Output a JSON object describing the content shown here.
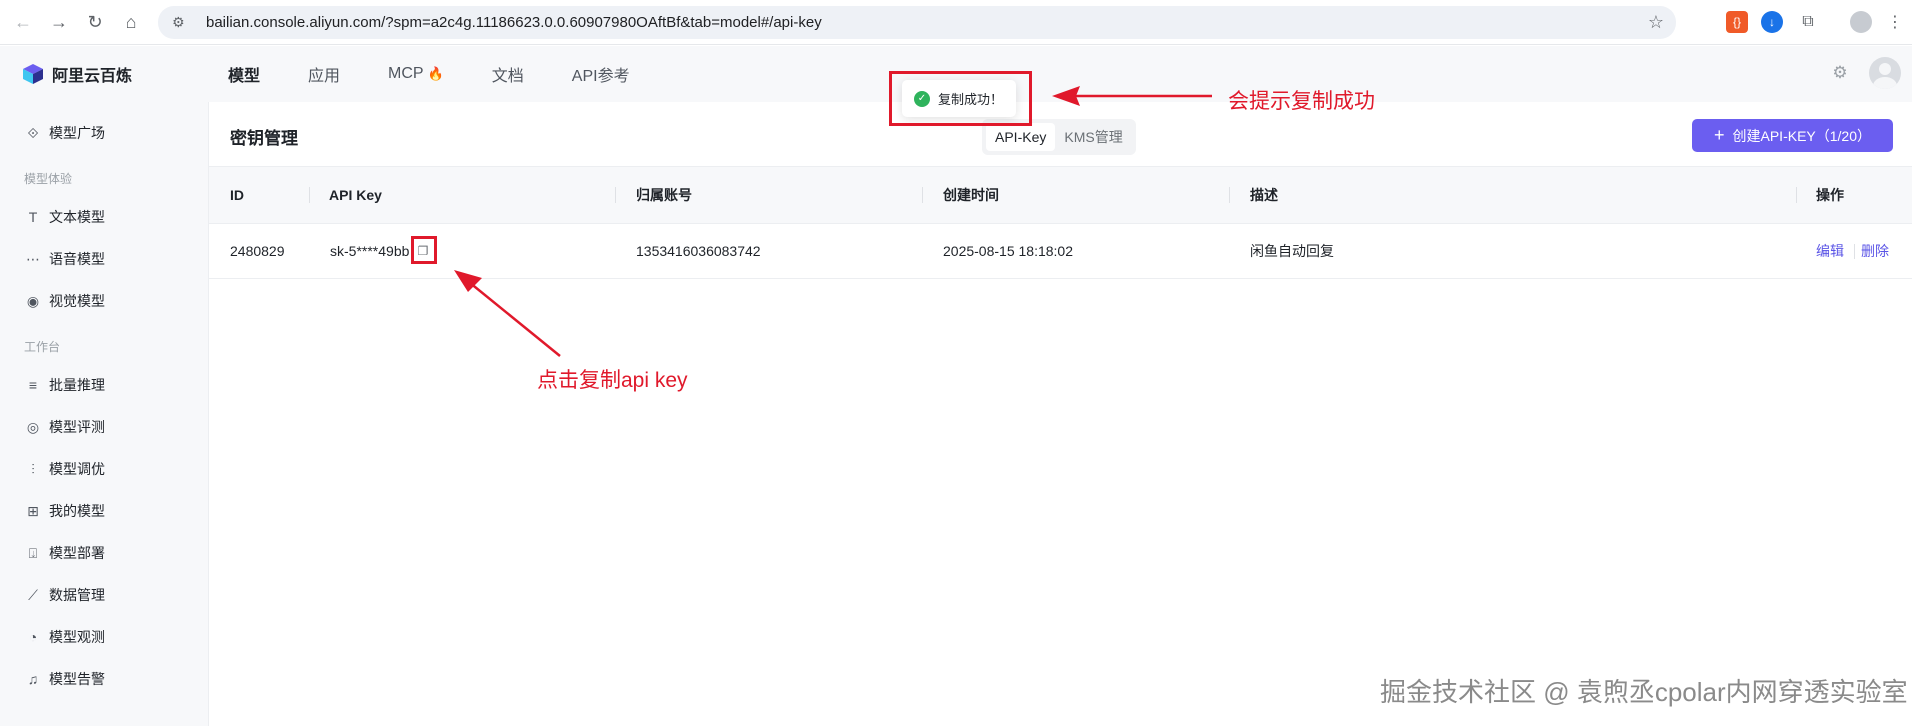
{
  "browser": {
    "url": "bailian.console.aliyun.com/?spm=a2c4g.11186623.0.0.60907980OAftBf&tab=model#/api-key"
  },
  "app": {
    "logo": "阿里云百炼",
    "nav": [
      {
        "label": "模型",
        "active": true
      },
      {
        "label": "应用"
      },
      {
        "label": "MCP"
      },
      {
        "label": "文档"
      },
      {
        "label": "API参考"
      }
    ]
  },
  "sidebar": {
    "model_square": "模型广场",
    "group_experience": "模型体验",
    "text_model": "文本模型",
    "voice_model": "语音模型",
    "vision_model": "视觉模型",
    "group_workbench": "工作台",
    "batch_inference": "批量推理",
    "model_eval": "模型评测",
    "model_tune": "模型调优",
    "my_models": "我的模型",
    "model_deploy": "模型部署",
    "data_manage": "数据管理",
    "model_observe": "模型观测",
    "model_alert": "模型告警"
  },
  "panel": {
    "title": "密钥管理",
    "tabs": [
      "API-Key",
      "KMS管理"
    ],
    "create_button": "创建API-KEY（1/20）"
  },
  "table": {
    "headers": [
      "ID",
      "API Key",
      "归属账号",
      "创建时间",
      "描述",
      "操作"
    ],
    "rows": [
      {
        "id": "2480829",
        "api_key": "sk-5****49bb",
        "account": "1353416036083742",
        "created": "2025-08-15 18:18:02",
        "description": "闲鱼自动回复",
        "edit": "编辑",
        "delete": "删除"
      }
    ]
  },
  "toast": {
    "message": "复制成功！"
  },
  "annotations": {
    "toast_note": "会提示复制成功",
    "copy_note": "点击复制api key"
  },
  "watermark": "掘金技术社区 @ 袁煦丞cpolar内网穿透实验室",
  "colors": {
    "accent": "#6b5ef0",
    "annotation": "#e0192b",
    "success": "#2fb35c"
  }
}
